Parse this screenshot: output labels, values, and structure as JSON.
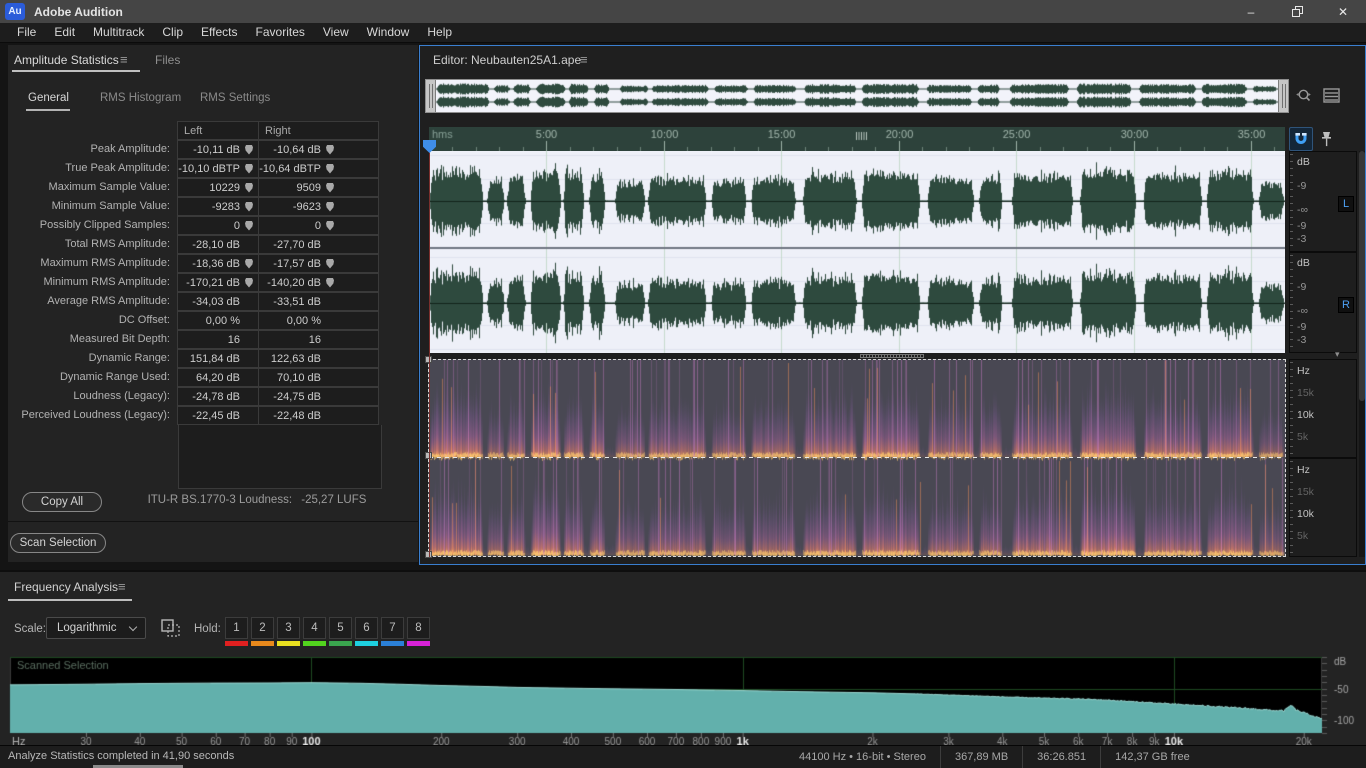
{
  "title_bar": {
    "app_title": "Adobe Audition",
    "logo_text": "Au"
  },
  "icons": {
    "hamburger": "≡",
    "minimize": "–",
    "close": "✕",
    "chevron_down": "▾"
  },
  "menu_bar": {
    "items": [
      "File",
      "Edit",
      "Multitrack",
      "Clip",
      "Effects",
      "Favorites",
      "View",
      "Window",
      "Help"
    ]
  },
  "stats_panel": {
    "tab_amplitude": "Amplitude Statistics",
    "tab_files": "Files",
    "inner_tabs": [
      "General",
      "RMS Histogram",
      "RMS Settings"
    ],
    "columns": [
      "Left",
      "Right"
    ],
    "rows": [
      {
        "label": "Peak Amplitude:",
        "left": "-10,11 dB",
        "right": "-10,64 dB",
        "pin": true
      },
      {
        "label": "True Peak Amplitude:",
        "left": "-10,10 dBTP",
        "right": "-10,64 dBTP",
        "pin": true
      },
      {
        "label": "Maximum Sample Value:",
        "left": "10229",
        "right": "9509",
        "pin": true
      },
      {
        "label": "Minimum Sample Value:",
        "left": "-9283",
        "right": "-9623",
        "pin": true
      },
      {
        "label": "Possibly Clipped Samples:",
        "left": "0",
        "right": "0",
        "pin": true
      },
      {
        "label": "Total RMS Amplitude:",
        "left": "-28,10 dB",
        "right": "-27,70 dB",
        "pin": false
      },
      {
        "label": "Maximum RMS Amplitude:",
        "left": "-18,36 dB",
        "right": "-17,57 dB",
        "pin": true
      },
      {
        "label": "Minimum RMS Amplitude:",
        "left": "-170,21 dB",
        "right": "-140,20 dB",
        "pin": true
      },
      {
        "label": "Average RMS Amplitude:",
        "left": "-34,03 dB",
        "right": "-33,51 dB",
        "pin": false
      },
      {
        "label": "DC Offset:",
        "left": "0,00 %",
        "right": "0,00 %",
        "pin": false
      },
      {
        "label": "Measured Bit Depth:",
        "left": "16",
        "right": "16",
        "pin": false
      },
      {
        "label": "Dynamic Range:",
        "left": "151,84 dB",
        "right": "122,63 dB",
        "pin": false
      },
      {
        "label": "Dynamic Range Used:",
        "left": "64,20 dB",
        "right": "70,10 dB",
        "pin": false
      },
      {
        "label": "Loudness (Legacy):",
        "left": "-24,78 dB",
        "right": "-24,75 dB",
        "pin": false
      },
      {
        "label": "Perceived Loudness (Legacy):",
        "left": "-22,45 dB",
        "right": "-22,48 dB",
        "pin": false
      }
    ],
    "copy_all_label": "Copy All",
    "loudness_label": "ITU-R BS.1770-3 Loudness:",
    "loudness_value": "-25,27 LUFS",
    "scan_selection_label": "Scan Selection"
  },
  "editor": {
    "title": "Editor: Neubauten25A1.ape",
    "timeline": {
      "unit": "hms",
      "major_ticks": [
        "5:00",
        "10:00",
        "15:00",
        "20:00",
        "25:00",
        "30:00",
        "35:00"
      ]
    },
    "amplitude_ruler": {
      "labels": [
        "dB",
        "-9",
        "-∞",
        "-9",
        "-3"
      ]
    },
    "frequency_ruler": {
      "labels": [
        "Hz",
        "15k",
        "10k",
        "5k"
      ]
    },
    "channels": [
      "L",
      "R"
    ]
  },
  "freq_panel": {
    "title": "Frequency Analysis",
    "scale_label": "Scale:",
    "scale_value": "Logarithmic",
    "hold_label": "Hold:",
    "holds": [
      {
        "n": "1",
        "color": "#e02020"
      },
      {
        "n": "2",
        "color": "#e8891c"
      },
      {
        "n": "3",
        "color": "#e8e020"
      },
      {
        "n": "4",
        "color": "#52d41e"
      },
      {
        "n": "5",
        "color": "#3aa54e"
      },
      {
        "n": "6",
        "color": "#1ed0e0"
      },
      {
        "n": "7",
        "color": "#2b80d8"
      },
      {
        "n": "8",
        "color": "#d822d8"
      }
    ]
  },
  "chart_data": {
    "type": "area",
    "title": "Frequency Analysis",
    "overlay_label": "Scanned Selection",
    "x_scale": "log",
    "x_unit": "Hz",
    "y_unit": "dB",
    "x_range": [
      20,
      22050
    ],
    "y_range": [
      -120,
      0
    ],
    "grid_frequencies": [
      100,
      1000,
      10000
    ],
    "grid_db": [
      0,
      -50,
      -100
    ],
    "x_ticks": [
      {
        "label": "30",
        "f": 30
      },
      {
        "label": "40",
        "f": 40
      },
      {
        "label": "50",
        "f": 50
      },
      {
        "label": "60",
        "f": 60
      },
      {
        "label": "70",
        "f": 70
      },
      {
        "label": "80",
        "f": 80
      },
      {
        "label": "90",
        "f": 90
      },
      {
        "label": "100",
        "f": 100,
        "strong": true
      },
      {
        "label": "200",
        "f": 200
      },
      {
        "label": "300",
        "f": 300
      },
      {
        "label": "400",
        "f": 400
      },
      {
        "label": "500",
        "f": 500
      },
      {
        "label": "600",
        "f": 600
      },
      {
        "label": "700",
        "f": 700
      },
      {
        "label": "800",
        "f": 800
      },
      {
        "label": "900",
        "f": 900
      },
      {
        "label": "1k",
        "f": 1000,
        "strong": true
      },
      {
        "label": "2k",
        "f": 2000
      },
      {
        "label": "3k",
        "f": 3000
      },
      {
        "label": "4k",
        "f": 4000
      },
      {
        "label": "5k",
        "f": 5000
      },
      {
        "label": "6k",
        "f": 6000
      },
      {
        "label": "7k",
        "f": 7000
      },
      {
        "label": "8k",
        "f": 8000
      },
      {
        "label": "9k",
        "f": 9000
      },
      {
        "label": "10k",
        "f": 10000,
        "strong": true
      },
      {
        "label": "20k",
        "f": 20000
      }
    ],
    "y_ticks": [
      {
        "label": "dB",
        "db": 0
      },
      {
        "label": "-50",
        "db": -50
      },
      {
        "label": "-100",
        "db": -100
      }
    ],
    "series": [
      {
        "name": "Scanned Selection",
        "color": "#62b0ac",
        "points": [
          [
            20,
            -44
          ],
          [
            30,
            -43
          ],
          [
            40,
            -42
          ],
          [
            50,
            -41.5
          ],
          [
            60,
            -41.2
          ],
          [
            80,
            -41
          ],
          [
            100,
            -40.5
          ],
          [
            130,
            -41.5
          ],
          [
            160,
            -43
          ],
          [
            200,
            -45
          ],
          [
            250,
            -46.5
          ],
          [
            300,
            -48
          ],
          [
            400,
            -49.3
          ],
          [
            500,
            -50.2
          ],
          [
            600,
            -50.8
          ],
          [
            700,
            -51.3
          ],
          [
            800,
            -52
          ],
          [
            900,
            -52.5
          ],
          [
            1000,
            -53
          ],
          [
            1300,
            -54.5
          ],
          [
            1600,
            -55.5
          ],
          [
            2000,
            -56.5
          ],
          [
            2500,
            -58.2
          ],
          [
            3000,
            -60
          ],
          [
            3500,
            -61.5
          ],
          [
            4000,
            -63
          ],
          [
            5000,
            -65
          ],
          [
            6000,
            -66.2
          ],
          [
            7000,
            -68
          ],
          [
            8000,
            -70.5
          ],
          [
            9000,
            -72.5
          ],
          [
            10000,
            -74.5
          ],
          [
            11000,
            -76
          ],
          [
            12000,
            -77.5
          ],
          [
            13000,
            -79
          ],
          [
            14000,
            -80.5
          ],
          [
            15000,
            -81.5
          ],
          [
            16000,
            -83
          ],
          [
            17000,
            -84.5
          ],
          [
            18000,
            -85
          ],
          [
            18700,
            -76
          ],
          [
            19200,
            -84
          ],
          [
            20000,
            -88
          ],
          [
            21000,
            -93
          ],
          [
            22000,
            -98
          ]
        ]
      }
    ]
  },
  "status_bar": {
    "message": "Analyze Statistics completed in 41,90 seconds",
    "format": "44100 Hz • 16-bit • Stereo",
    "file_size": "367,89 MB",
    "duration": "36:26.851",
    "free_space": "142,37 GB free"
  },
  "colors": {
    "accent_blue": "#3f8ee8",
    "panel_bg": "#232323",
    "timeline_bg": "#2d423b",
    "waveform_green": "#2e4a3e",
    "waveform_bg": "#eef0f8",
    "spectrogram_bg": "#46464e",
    "spectrogram_hot": "#ffaa5a",
    "spectrogram_mid": "#b969aa",
    "freq_fill": "#62b0ac",
    "grid_green": "#1e4a22"
  }
}
